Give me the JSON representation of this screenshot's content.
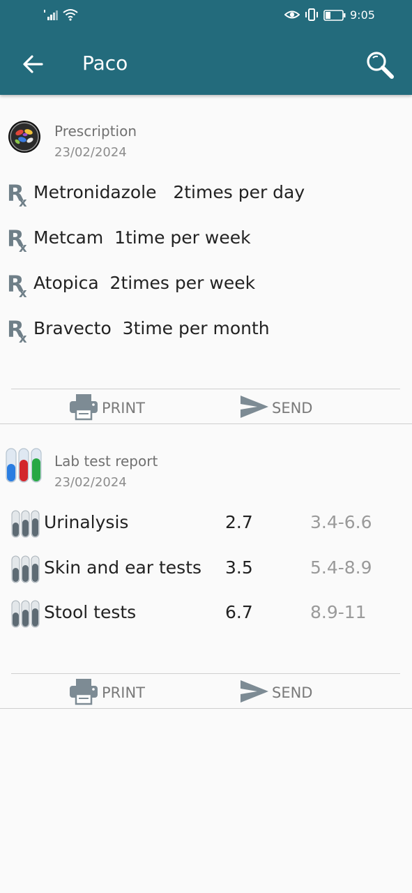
{
  "status_bar": {
    "time": "9:05"
  },
  "header": {
    "title": "Paco",
    "back_icon": "arrow-left-icon",
    "search_icon": "search-icon"
  },
  "prescription": {
    "title": "Prescription",
    "date": "23/02/2024",
    "items": [
      {
        "text": "Metronidazole   2times per day"
      },
      {
        "text": "Metcam  1time per week"
      },
      {
        "text": "Atopica  2times per week"
      },
      {
        "text": "Bravecto  3time per month"
      }
    ],
    "print_label": "PRINT",
    "send_label": "SEND"
  },
  "lab_report": {
    "title": "Lab test report",
    "date": "23/02/2024",
    "rows": [
      {
        "name": "Urinalysis",
        "value": "2.7",
        "range": "3.4-6.6"
      },
      {
        "name": "Skin and ear tests",
        "value": "3.5",
        "range": "5.4-8.9"
      },
      {
        "name": "Stool tests",
        "value": "6.7",
        "range": "8.9-11"
      }
    ],
    "print_label": "PRINT",
    "send_label": "SEND"
  },
  "colors": {
    "app_bar": "#236b7c",
    "background": "#fafafa",
    "icon_gray": "#6f7f88"
  }
}
